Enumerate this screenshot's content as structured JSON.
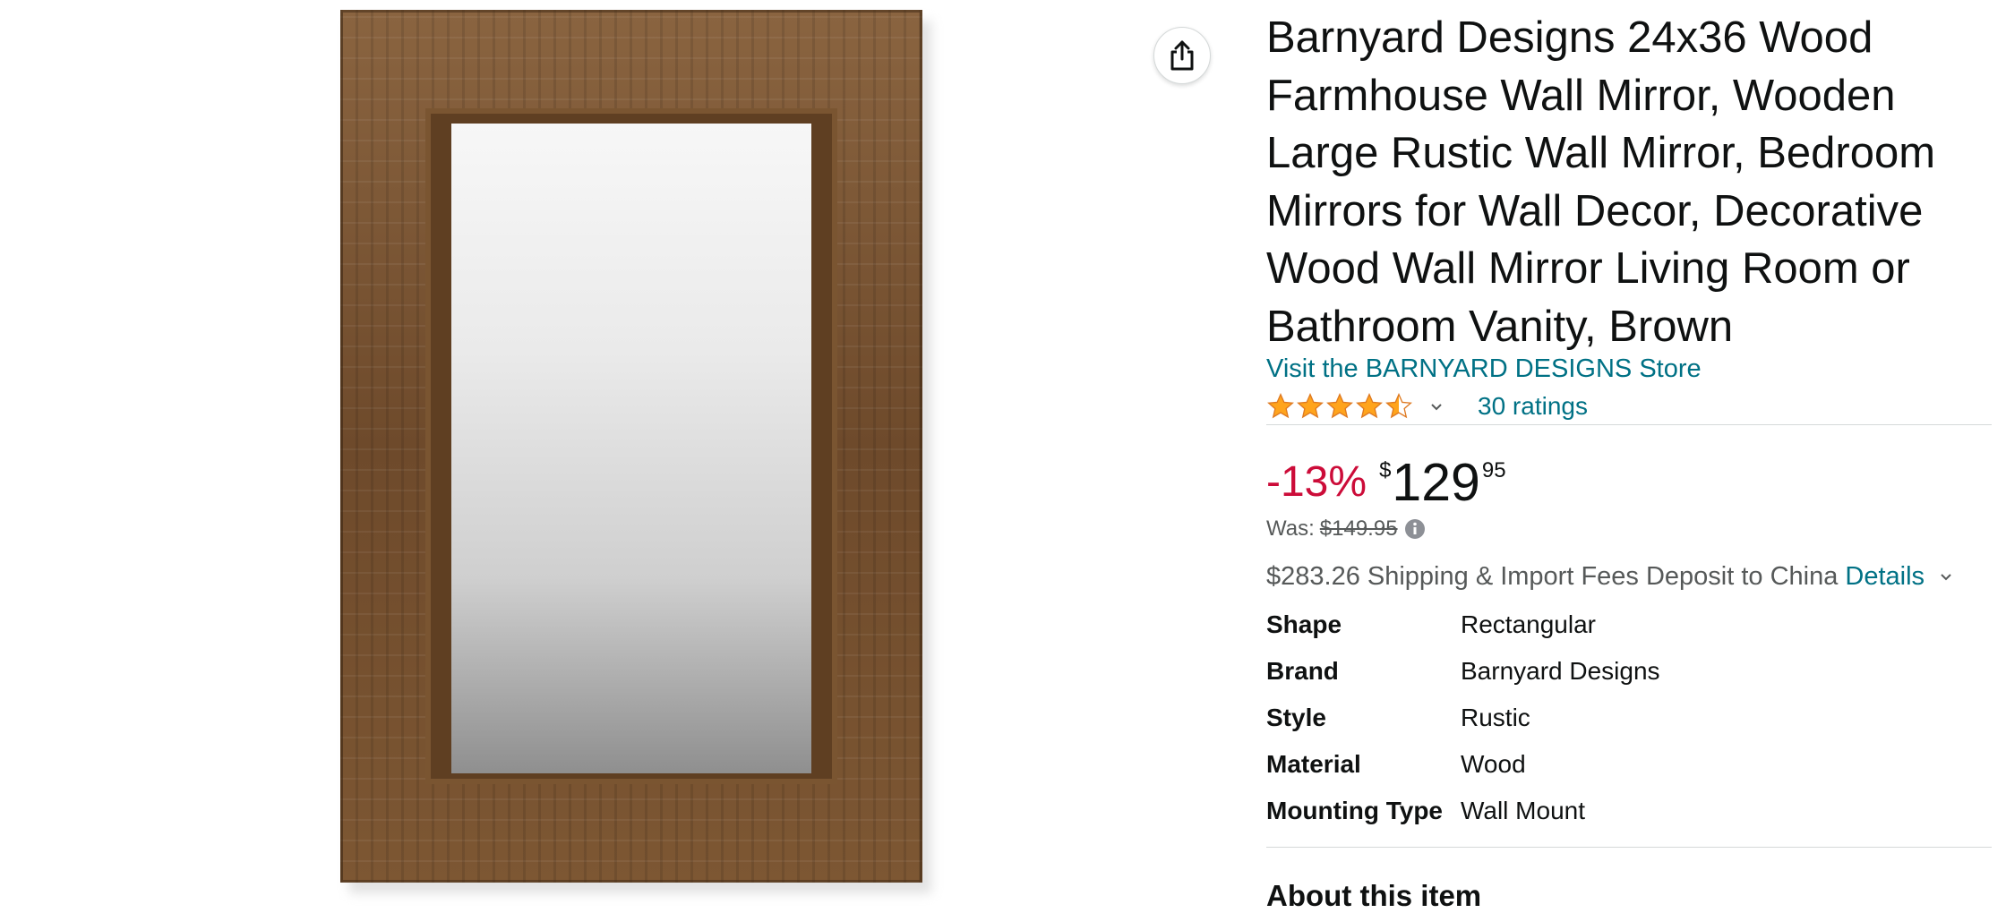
{
  "product": {
    "title": "Barnyard Designs 24x36 Wood Farmhouse Wall Mirror, Wooden Large Rustic Wall Mirror, Bedroom Mirrors for Wall Decor, Decorative Wood Wall Mirror Living Room or Bathroom Vanity, Brown",
    "store_link": "Visit the BARNYARD DESIGNS Store",
    "rating": {
      "stars": 4.5,
      "count_label": "30 ratings"
    },
    "price": {
      "discount": "-13%",
      "currency_symbol": "$",
      "whole": "129",
      "fraction": "95",
      "was_label": "Was:",
      "was_price": "$149.95"
    },
    "shipping": {
      "text": "$283.26 Shipping & Import Fees Deposit to China",
      "details_link": "Details"
    },
    "specs": [
      {
        "label": "Shape",
        "value": "Rectangular"
      },
      {
        "label": "Brand",
        "value": "Barnyard Designs"
      },
      {
        "label": "Style",
        "value": "Rustic"
      },
      {
        "label": "Material",
        "value": "Wood"
      },
      {
        "label": "Mounting Type",
        "value": "Wall Mount"
      }
    ],
    "about_heading": "About this item"
  },
  "icons": {
    "share": "share-icon",
    "star": "star-icon",
    "chevron": "chevron-down-icon",
    "info": "info-icon"
  },
  "colors": {
    "link": "#007185",
    "discount": "#cc0c39",
    "star": "#ffa41c",
    "text": "#0f1111",
    "muted": "#565959"
  }
}
